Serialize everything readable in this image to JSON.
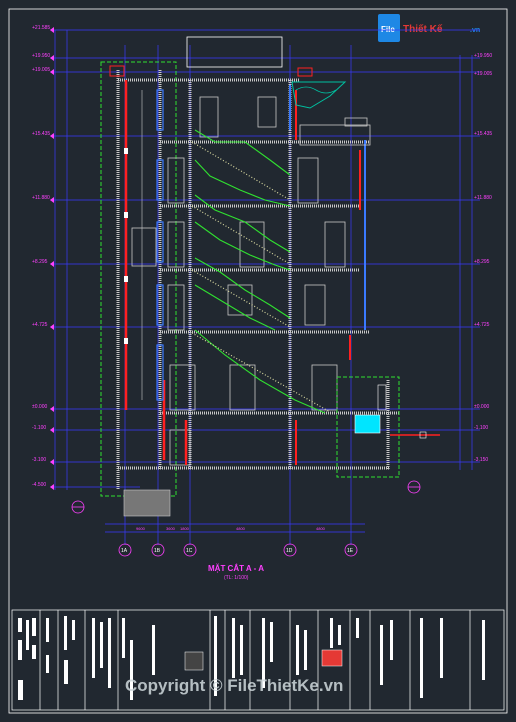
{
  "watermark_top": {
    "prefix": "File",
    "rest": "Thiết Kế",
    "suffix": ".vn"
  },
  "watermark_bottom": "Copyright © FileThietKe.vn",
  "section_title": "MẶT CẮT A - A",
  "section_scale": "(TL: 1/100)",
  "levels_left": [
    "+21.585",
    "+19.950",
    "+19.005",
    "+15.435",
    "+11.880",
    "+8.295",
    "+4.725",
    "±0.000",
    "-1.100",
    "-3.100",
    "-4.500"
  ],
  "levels_right": [
    "+19.950",
    "+19.005",
    "+15.435",
    "+11.880",
    "+8.295",
    "+4.725",
    "±0.000",
    "-1.100",
    "-3.150"
  ],
  "bottom_dims": [
    "9600",
    "3600",
    "1800",
    "4800",
    "4800"
  ],
  "grid_axes": [
    "1A",
    "1B",
    "1C",
    "1D",
    "1E"
  ],
  "colors": {
    "background": "#212830",
    "level_text": "#ff40ff",
    "dimension_line": "#3a3aff",
    "structure": "#d8d8d8",
    "stair": "#30e030",
    "frame": "#ffffff",
    "accent_red": "#ff2020",
    "accent_cyan": "#00e5ff",
    "watermark_blue": "#1e88e5",
    "watermark_red": "#e53935"
  }
}
